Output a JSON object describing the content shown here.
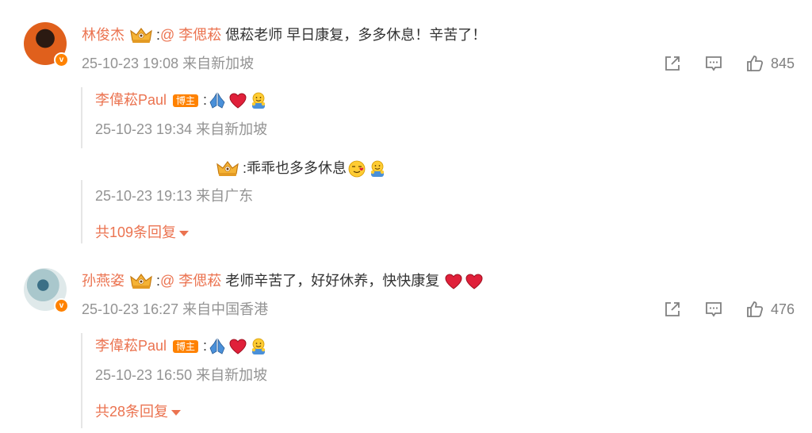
{
  "icons": {
    "verified": "verified-v-badge",
    "crown": "fan-crown-badge",
    "share": "share-icon",
    "comment": "comment-icon",
    "like": "thumbs-up-icon"
  },
  "colors": {
    "name": "#eb7350",
    "meta": "#939393",
    "badge": "#ff8200"
  },
  "comments": [
    {
      "user": "林俊杰",
      "sep": ":",
      "mention": "@ 李偲菘",
      "text": " 偲菘老师 早日康复，多多休息！辛苦了！",
      "meta": "25-10-23 19:08 来自新加坡",
      "likes": "845",
      "replies": [
        {
          "user": "李偉菘Paul",
          "badge": "博主",
          "sep": ":",
          "emoji": [
            "🙏",
            "❤️",
            "🤗"
          ],
          "meta": "25-10-23 19:34 来自新加坡"
        },
        {
          "user": "",
          "sep": ":",
          "text": "乖乖也多多休息",
          "emoji": [
            "🥰",
            "🤗"
          ],
          "meta": "25-10-23 19:13 来自广东"
        }
      ],
      "more_replies": "共109条回复"
    },
    {
      "user": "孙燕姿",
      "sep": ":",
      "mention": "@ 李偲菘",
      "text": " 老师辛苦了，好好休养，快快康复",
      "emoji": [
        "❤️",
        "❤️"
      ],
      "meta": "25-10-23 16:27 来自中国香港",
      "likes": "476",
      "replies": [
        {
          "user": "李偉菘Paul",
          "badge": "博主",
          "sep": ":",
          "emoji": [
            "🙏",
            "❤️",
            "🤗"
          ],
          "meta": "25-10-23 16:50 来自新加坡"
        }
      ],
      "more_replies": "共28条回复"
    }
  ]
}
